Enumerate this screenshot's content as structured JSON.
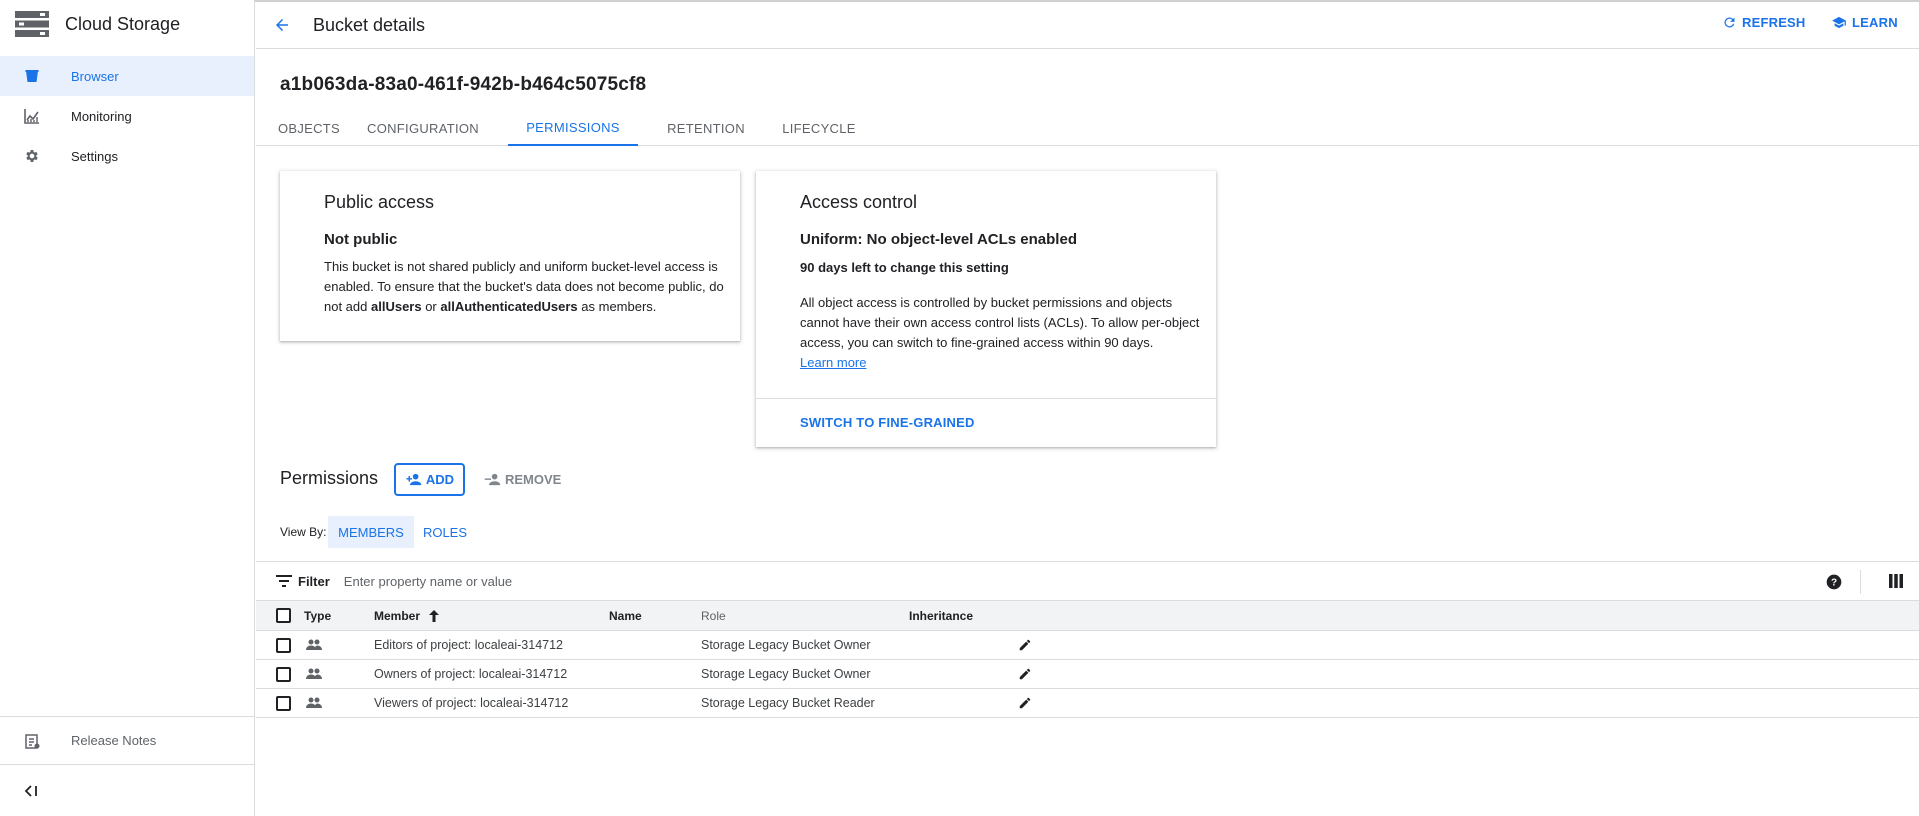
{
  "sidebar": {
    "product_title": "Cloud Storage",
    "items": [
      {
        "label": "Browser",
        "icon": "bucket-icon",
        "active": true
      },
      {
        "label": "Monitoring",
        "icon": "chart-icon",
        "active": false
      },
      {
        "label": "Settings",
        "icon": "gear-icon",
        "active": false
      }
    ],
    "release_notes": "Release Notes",
    "collapse_icon": "collapse-sidebar-icon"
  },
  "header": {
    "title": "Bucket details",
    "refresh": "REFRESH",
    "learn": "LEARN"
  },
  "bucket": {
    "name": "a1b063da-83a0-461f-942b-b464c5075cf8"
  },
  "tabs": [
    {
      "label": "OBJECTS",
      "active": false
    },
    {
      "label": "CONFIGURATION",
      "active": false
    },
    {
      "label": "PERMISSIONS",
      "active": true
    },
    {
      "label": "RETENTION",
      "active": false
    },
    {
      "label": "LIFECYCLE",
      "active": false
    }
  ],
  "public_access": {
    "title": "Public access",
    "status": "Not public",
    "desc_pre": "This bucket is not shared publicly and uniform bucket-level access is enabled. To ensure that the bucket's data does not become public, do not add ",
    "desc_bold1": "allUsers",
    "desc_mid": " or ",
    "desc_bold2": "allAuthenticatedUsers",
    "desc_post": " as members."
  },
  "access_control": {
    "title": "Access control",
    "status": "Uniform: No object-level ACLs enabled",
    "days_left": "90 days left to change this setting",
    "desc": "All object access is controlled by bucket permissions and objects cannot have their own access control lists (ACLs). To allow per-object access, you can switch to fine-grained access within 90 days.",
    "learn_more": "Learn more",
    "switch_button": "SWITCH TO FINE-GRAINED"
  },
  "permissions": {
    "title": "Permissions",
    "add": "ADD",
    "remove": "REMOVE",
    "view_by_label": "View By:",
    "view_by": [
      {
        "label": "MEMBERS",
        "active": true
      },
      {
        "label": "ROLES",
        "active": false
      }
    ]
  },
  "filter": {
    "label": "Filter",
    "placeholder": "Enter property name or value"
  },
  "table": {
    "columns": {
      "type": "Type",
      "member": "Member",
      "name": "Name",
      "role": "Role",
      "inheritance": "Inheritance"
    },
    "sort": {
      "column": "Member",
      "direction": "ascending"
    },
    "rows": [
      {
        "member": "Editors of project: localeai-314712",
        "name": "",
        "role": "Storage Legacy Bucket Owner",
        "inheritance": "",
        "type_icon": "group-icon"
      },
      {
        "member": "Owners of project: localeai-314712",
        "name": "",
        "role": "Storage Legacy Bucket Owner",
        "inheritance": "",
        "type_icon": "group-icon"
      },
      {
        "member": "Viewers of project: localeai-314712",
        "name": "",
        "role": "Storage Legacy Bucket Reader",
        "inheritance": "",
        "type_icon": "group-icon"
      }
    ]
  },
  "colors": {
    "accent": "#1a73e8",
    "active_bg": "#e8f0fe",
    "border": "#dadce0",
    "header_bg": "#f1f3f4"
  }
}
